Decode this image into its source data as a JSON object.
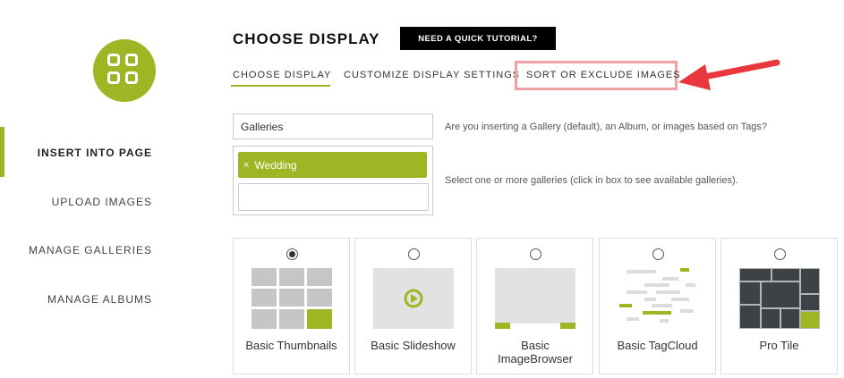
{
  "sidebar": {
    "items": [
      {
        "label": "INSERT INTO PAGE",
        "active": true
      },
      {
        "label": "UPLOAD IMAGES",
        "active": false
      },
      {
        "label": "MANAGE GALLERIES",
        "active": false
      },
      {
        "label": "MANAGE ALBUMS",
        "active": false
      }
    ],
    "logo_icon": "grid-icon"
  },
  "header": {
    "title": "CHOOSE DISPLAY",
    "tutorial_button": "NEED A QUICK TUTORIAL?"
  },
  "tabs": [
    {
      "label": "CHOOSE DISPLAY",
      "active": true
    },
    {
      "label": "CUSTOMIZE DISPLAY SETTINGS",
      "active": false
    },
    {
      "label": "SORT OR EXCLUDE IMAGES",
      "active": false,
      "highlighted": true
    }
  ],
  "source": {
    "value": "Galleries",
    "help": "Are you inserting a Gallery (default), an Album, or images based on Tags?"
  },
  "galleries": {
    "selected_tags": [
      "Wedding"
    ],
    "remove_glyph": "×",
    "help": "Select one or more galleries (click in box to see available galleries)."
  },
  "display_types": [
    {
      "label": "Basic Thumbnails",
      "selected": true
    },
    {
      "label": "Basic Slideshow",
      "selected": false
    },
    {
      "label": "Basic ImageBrowser",
      "selected": false
    },
    {
      "label": "Basic TagCloud",
      "selected": false
    },
    {
      "label": "Pro Tile",
      "selected": false
    }
  ],
  "colors": {
    "accent": "#9fb624",
    "annotation_arrow": "#e8383d"
  }
}
